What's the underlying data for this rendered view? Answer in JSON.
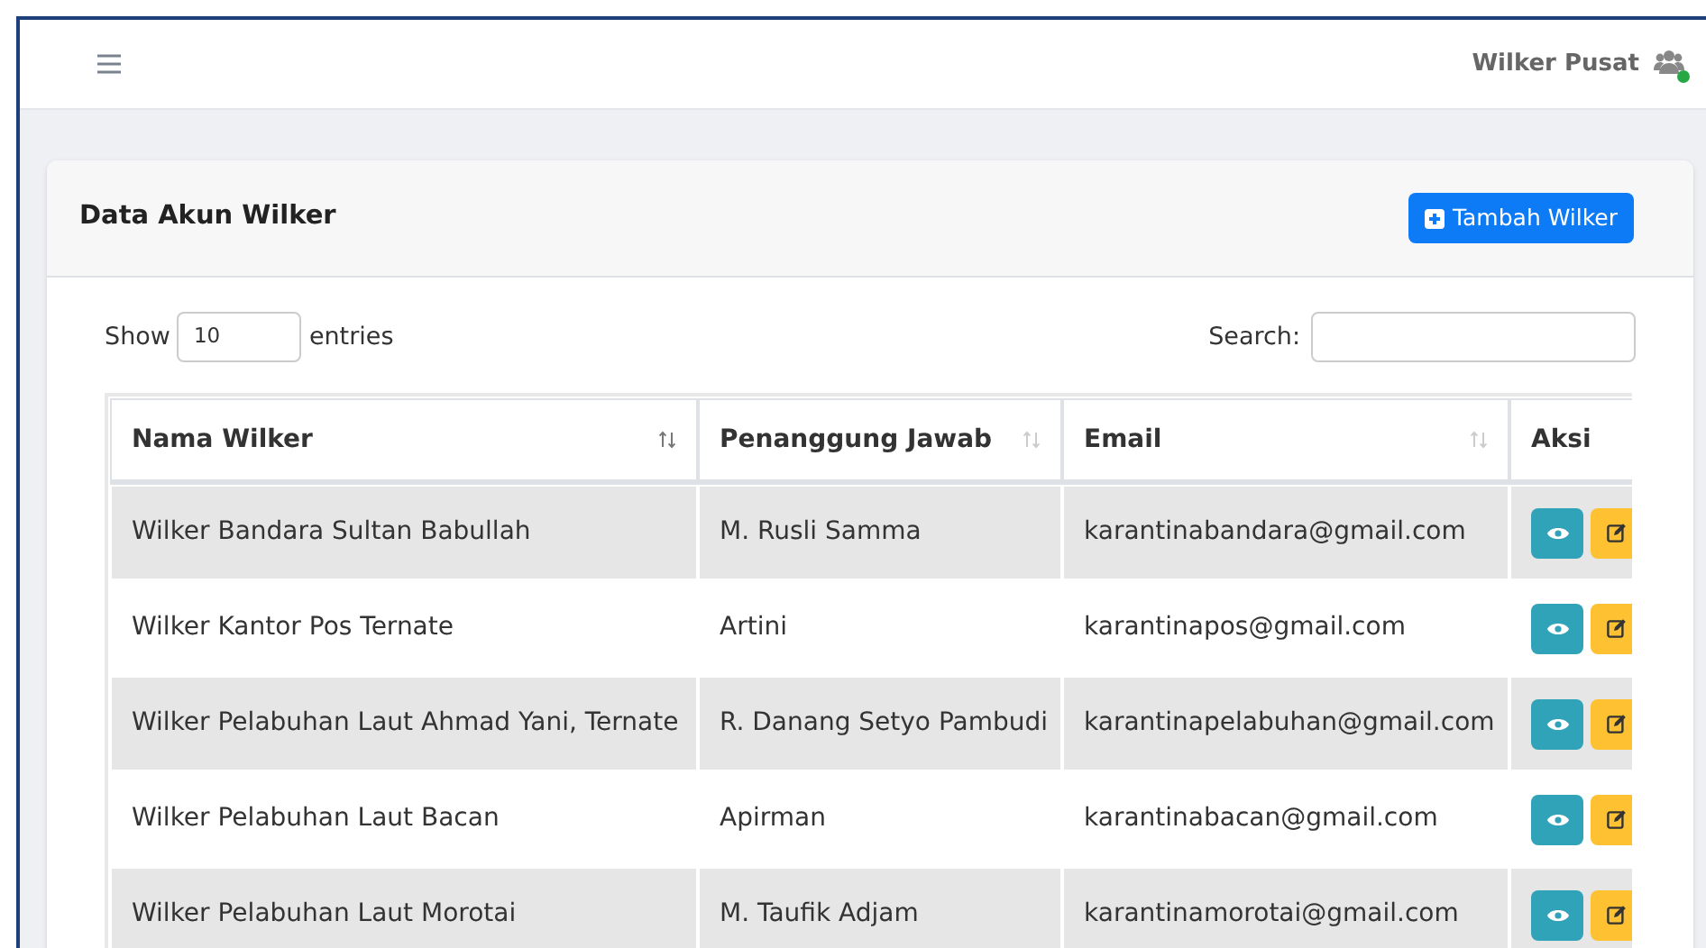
{
  "navbar": {
    "user_name": "Wilker Pusat",
    "online": true
  },
  "card": {
    "title": "Data Akun Wilker",
    "add_button": "Tambah Wilker"
  },
  "table_controls": {
    "show_label": "Show",
    "page_size": "10",
    "entries_label": "entries",
    "search_label": "Search:"
  },
  "table": {
    "columns": [
      {
        "label": "Nama Wilker",
        "sortable": true
      },
      {
        "label": "Penanggung Jawab",
        "sortable": true
      },
      {
        "label": "Email",
        "sortable": true
      },
      {
        "label": "Aksi",
        "sortable": false
      }
    ],
    "rows": [
      {
        "cells": [
          "Wilker Bandara Sultan Babullah",
          "M. Rusli Samma",
          "karantinabandara@gmail.com"
        ]
      },
      {
        "cells": [
          "Wilker Kantor Pos Ternate",
          "Artini",
          "karantinapos@gmail.com"
        ]
      },
      {
        "cells": [
          "Wilker Pelabuhan Laut Ahmad Yani, Ternate",
          "R. Danang Setyo Pambudi",
          "karantinapelabuhan@gmail.com"
        ]
      },
      {
        "cells": [
          "Wilker Pelabuhan Laut Bacan",
          "Apirman",
          "karantinabacan@gmail.com"
        ]
      },
      {
        "cells": [
          "Wilker Pelabuhan Laut Morotai",
          "M. Taufik Adjam",
          "karantinamorotai@gmail.com"
        ]
      }
    ]
  }
}
